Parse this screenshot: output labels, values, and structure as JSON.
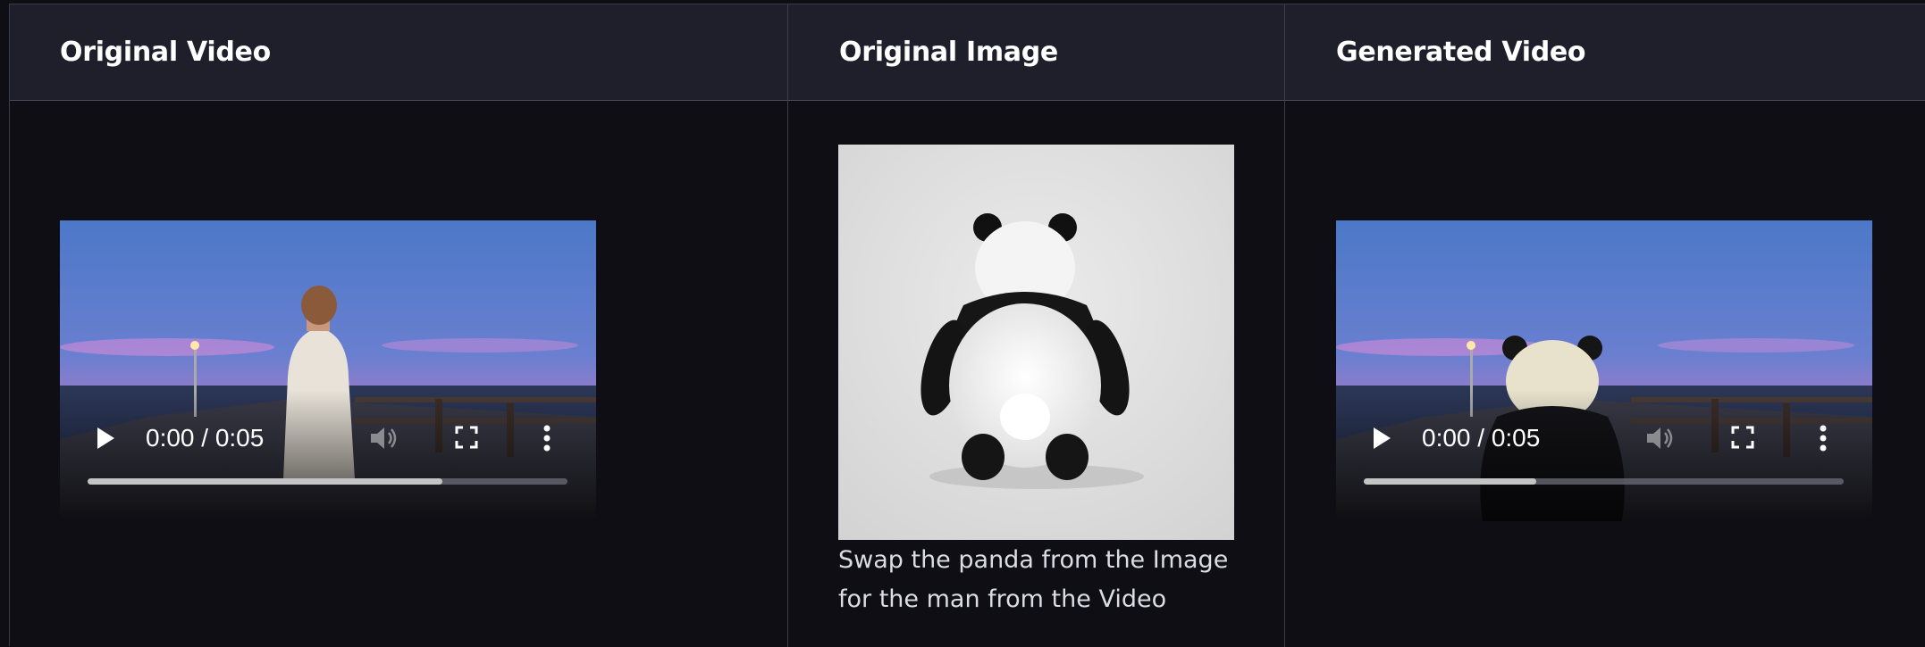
{
  "columns": [
    {
      "title": "Original Video"
    },
    {
      "title": "Original Image"
    },
    {
      "title": "Generated Video"
    }
  ],
  "original_video": {
    "time_display": "0:00 / 0:05",
    "progress_fraction": 0.74
  },
  "generated_video": {
    "time_display": "0:00 / 0:05",
    "progress_fraction": 0.36
  },
  "original_image": {
    "caption": "Swap the panda from the Image for the man from the Video"
  },
  "icons": {
    "play": "play-icon",
    "volume": "volume-icon",
    "fullscreen": "fullscreen-icon",
    "more": "more-options-icon"
  }
}
